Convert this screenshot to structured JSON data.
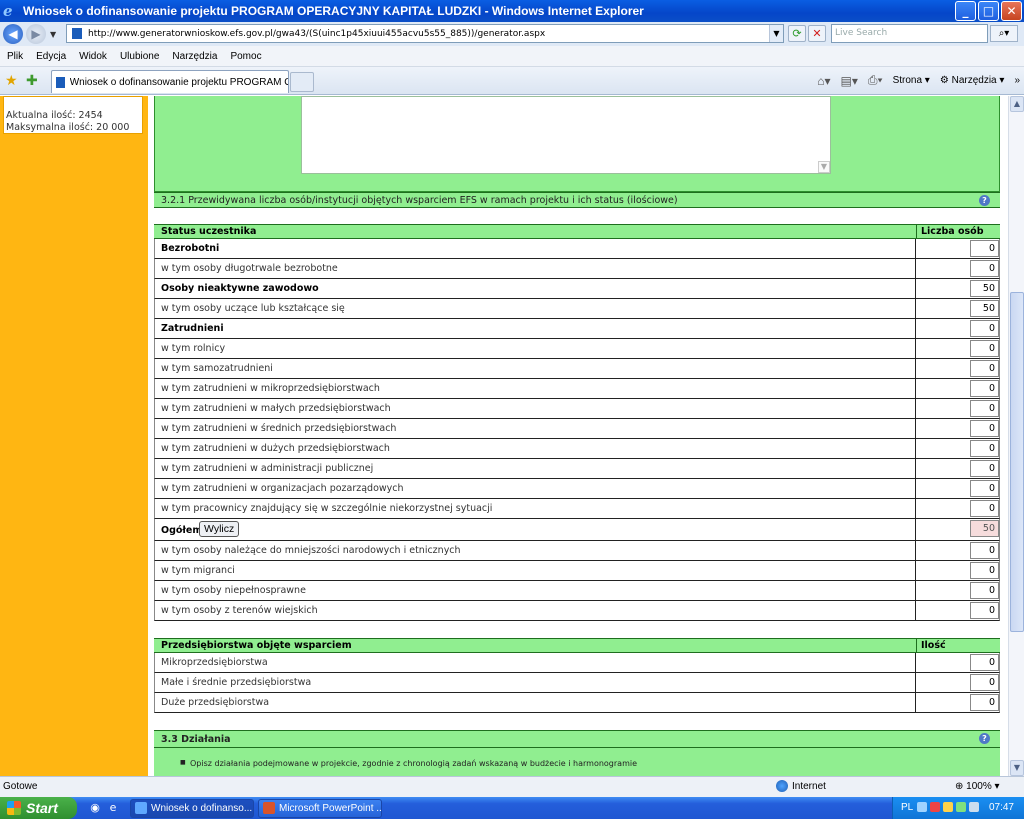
{
  "window": {
    "title": "Wniosek o dofinansowanie projektu PROGRAM OPERACYJNY KAPITAŁ LUDZKI - Windows Internet Explorer",
    "minimize": "_",
    "maximize": "□",
    "close": "✕"
  },
  "address": {
    "url": "http://www.generatorwnioskow.efs.gov.pl/gwa43/(S(uinc1p45xiuui455acvu5s55_885))/generator.aspx",
    "search_placeholder": "Live Search"
  },
  "menu": [
    "Plik",
    "Edycja",
    "Widok",
    "Ulubione",
    "Narzędzia",
    "Pomoc"
  ],
  "tab": {
    "title": "Wniosek o dofinansowanie projektu PROGRAM OPER..."
  },
  "commandbar": {
    "page": "Strona",
    "tools": "Narzędzia"
  },
  "sidebar": {
    "current": "Aktualna ilość: 2454",
    "max": "Maksymalna ilość: 20 000"
  },
  "section_321": {
    "title": "3.2.1 Przewidywana liczba osób/instytucji objętych wsparciem EFS w ramach projektu i ich status (ilościowe)",
    "col_status": "Status uczestnika",
    "col_count": "Liczba osób",
    "rows": [
      {
        "label": "Bezrobotni",
        "bold": true,
        "value": "0"
      },
      {
        "label": "w tym osoby długotrwale bezrobotne",
        "bold": false,
        "value": "0"
      },
      {
        "label": "Osoby nieaktywne zawodowo",
        "bold": true,
        "value": "50"
      },
      {
        "label": "w tym osoby uczące lub kształcące się",
        "bold": false,
        "value": "50"
      },
      {
        "label": "Zatrudnieni",
        "bold": true,
        "value": "0"
      },
      {
        "label": "w tym rolnicy",
        "bold": false,
        "value": "0"
      },
      {
        "label": "w tym samozatrudnieni",
        "bold": false,
        "value": "0"
      },
      {
        "label": "w tym zatrudnieni w mikroprzedsiębiorstwach",
        "bold": false,
        "value": "0"
      },
      {
        "label": "w tym zatrudnieni w małych przedsiębiorstwach",
        "bold": false,
        "value": "0"
      },
      {
        "label": "w tym zatrudnieni w średnich przedsiębiorstwach",
        "bold": false,
        "value": "0"
      },
      {
        "label": "w tym zatrudnieni w dużych przedsiębiorstwach",
        "bold": false,
        "value": "0"
      },
      {
        "label": "w tym zatrudnieni w administracji publicznej",
        "bold": false,
        "value": "0"
      },
      {
        "label": "w tym zatrudnieni w organizacjach pozarządowych",
        "bold": false,
        "value": "0"
      },
      {
        "label": "w tym pracownicy znajdujący się w szczególnie niekorzystnej sytuacji",
        "bold": false,
        "value": "0"
      }
    ],
    "total_label": "Ogółem",
    "calc_button": "Wylicz",
    "total_value": "50",
    "rows_after": [
      {
        "label": "w tym osoby należące do mniejszości narodowych i etnicznych",
        "value": "0"
      },
      {
        "label": "w tym migranci",
        "value": "0"
      },
      {
        "label": "w tym osoby niepełnosprawne",
        "value": "0"
      },
      {
        "label": "w tym osoby z terenów wiejskich",
        "value": "0"
      }
    ]
  },
  "enterprises": {
    "col_name": "Przedsiębiorstwa objęte wsparciem",
    "col_count": "Ilość",
    "rows": [
      {
        "label": "Mikroprzedsiębiorstwa",
        "value": "0"
      },
      {
        "label": "Małe i średnie przedsiębiorstwa",
        "value": "0"
      },
      {
        "label": "Duże przedsiębiorstwa",
        "value": "0"
      }
    ]
  },
  "section_33": {
    "title": "3.3 Działania",
    "bullet": "Opisz działania podejmowane w projekcie, zgodnie z chronologią zadań wskazaną w budżecie i harmonogramie"
  },
  "status": {
    "left": "Gotowe",
    "zone": "Internet",
    "zoom": "100%"
  },
  "taskbar": {
    "start": "Start",
    "tasks": [
      "Wniosek o dofinanso...",
      "Microsoft PowerPoint ..."
    ],
    "lang": "PL",
    "time": "07:47"
  },
  "colors": {
    "green_bg": "#90ee90",
    "sidebar": "#ffb612",
    "titlebar": "#0546c9"
  }
}
